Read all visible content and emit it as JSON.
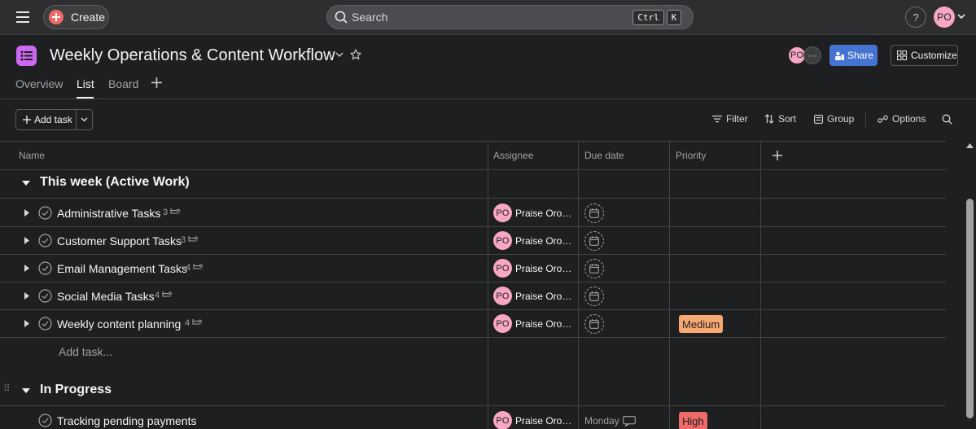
{
  "topbar": {
    "create_label": "Create",
    "search_placeholder": "Search",
    "shortcut_ctrl": "Ctrl",
    "shortcut_k": "K",
    "help_label": "?",
    "user_initials": "PO"
  },
  "project": {
    "title": "Weekly Operations & Content Workflow",
    "member_initials": "PO",
    "member_more": "···",
    "share_label": "Share",
    "customize_label": "Customize"
  },
  "tabs": [
    {
      "label": "Overview",
      "active": false
    },
    {
      "label": "List",
      "active": true
    },
    {
      "label": "Board",
      "active": false
    }
  ],
  "toolbar": {
    "add_task_label": "Add task",
    "filter_label": "Filter",
    "sort_label": "Sort",
    "group_label": "Group",
    "options_label": "Options"
  },
  "columns": {
    "name": "Name",
    "assignee": "Assignee",
    "due_date": "Due date",
    "priority": "Priority"
  },
  "sections": [
    {
      "title": "This week (Active Work)",
      "add_task_label": "Add task...",
      "tasks": [
        {
          "name": "Administrative Tasks",
          "subtasks": "3",
          "assignee_initials": "PO",
          "assignee": "Praise Orogo...",
          "due": "",
          "priority": ""
        },
        {
          "name": "Customer Support Tasks",
          "subtasks": "3",
          "assignee_initials": "PO",
          "assignee": "Praise Orogo...",
          "due": "",
          "priority": ""
        },
        {
          "name": "Email Management Tasks",
          "subtasks": "4",
          "assignee_initials": "PO",
          "assignee": "Praise Orogo...",
          "due": "",
          "priority": ""
        },
        {
          "name": "Social Media Tasks",
          "subtasks": "4",
          "assignee_initials": "PO",
          "assignee": "Praise Orogo...",
          "due": "",
          "priority": ""
        },
        {
          "name": "Weekly content planning",
          "subtasks": "4",
          "assignee_initials": "PO",
          "assignee": "Praise Orogo...",
          "due": "",
          "priority": "Medium"
        }
      ]
    },
    {
      "title": "In Progress",
      "tasks": [
        {
          "name": "Tracking pending payments",
          "subtasks": "",
          "assignee_initials": "PO",
          "assignee": "Praise Orogo...",
          "due": "Monday",
          "priority": "High"
        }
      ]
    }
  ],
  "colors": {
    "background": "#1e1f21",
    "topbar": "#2e2e30",
    "accent_create": "#f06a6a",
    "share_blue": "#4573d2",
    "project_icon": "#cd68f2",
    "avatar_pink": "#f7a6c4",
    "priority_medium": "#f8a971",
    "priority_high": "#f06a6a"
  },
  "icons": [
    "hamburger-icon",
    "plus-icon",
    "search-icon",
    "chevron-down-icon",
    "star-icon",
    "share-icon",
    "customize-icon",
    "filter-icon",
    "sort-icon",
    "group-icon",
    "options-icon",
    "caret-down-icon",
    "caret-right-icon",
    "check-circle-icon",
    "subtask-icon",
    "calendar-icon",
    "recurring-icon"
  ]
}
